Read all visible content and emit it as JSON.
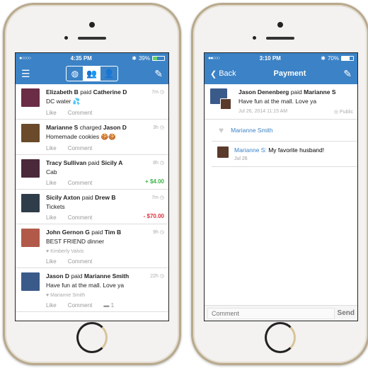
{
  "left": {
    "status": {
      "signal": "●○○○○",
      "time": "4:35 PM",
      "battery": "39%",
      "battery_level": 0.39
    },
    "nav": {
      "menu_icon": "hamburger-icon",
      "tabs": [
        {
          "icon": "globe-icon",
          "glyph": "◍"
        },
        {
          "icon": "friends-icon",
          "glyph": "👥",
          "active": true
        },
        {
          "icon": "person-icon",
          "glyph": "👤"
        }
      ],
      "compose_icon": "compose-icon"
    },
    "feed": [
      {
        "actor": "Elizabeth B",
        "verb": "paid",
        "target": "Catherine D",
        "message": "DC water 💦",
        "time": "7m",
        "like": "Like",
        "comment": "Comment",
        "avatar_color": "#6b2c45"
      },
      {
        "actor": "Marianne S",
        "verb": "charged",
        "target": "Jason D",
        "message": "Homemade cookies 🍪🍪",
        "time": "3h",
        "like": "Like",
        "comment": "Comment",
        "avatar_color": "#6a4a2a"
      },
      {
        "actor": "Tracy Sullivan",
        "verb": "paid",
        "target": "Sicily A",
        "message": "Cab",
        "time": "8h",
        "like": "Like",
        "comment": "Comment",
        "amount": "+ $4.00",
        "amount_type": "pos",
        "avatar_color": "#4a2a3a"
      },
      {
        "actor": "Sicily Axton",
        "verb": "paid",
        "target": "Drew B",
        "message": "Tickets",
        "time": "7m",
        "like": "Like",
        "comment": "Comment",
        "amount": "- $70.00",
        "amount_type": "neg",
        "avatar_color": "#2f3d4a"
      },
      {
        "actor": "John Gernon G",
        "verb": "paid",
        "target": "Tim B",
        "message": "BEST FRIEND dinner",
        "time": "9h",
        "liked_by": "Kimberly Valvis",
        "like": "Like",
        "comment": "Comment",
        "avatar_color": "#b25a4a"
      },
      {
        "actor": "Jason D",
        "verb": "paid",
        "target": "Marianne Smith",
        "message": "Have fun at the mall. Love ya",
        "time": "22h",
        "liked_by": "Marianne Smith",
        "like": "Like",
        "comment": "Comment",
        "comment_count": "1",
        "avatar_color": "#3a5a8a"
      }
    ]
  },
  "right": {
    "status": {
      "signal": "●●○○○",
      "time": "3:10 PM",
      "battery": "70%",
      "battery_level": 0.7
    },
    "nav": {
      "back": "Back",
      "title": "Payment"
    },
    "payment": {
      "actor": "Jason Denenberg",
      "verb": "paid",
      "target": "Marianne S",
      "message": "Have fun at the mall. Love ya",
      "date": "Jul 26, 2014 11:15 AM",
      "privacy": "Public"
    },
    "liked_by": "Marianne Smith",
    "comment": {
      "author": "Marianne S:",
      "text": "My favorite husband!",
      "date": "Jul 26"
    },
    "input": {
      "placeholder": "Comment",
      "send": "Send"
    }
  }
}
